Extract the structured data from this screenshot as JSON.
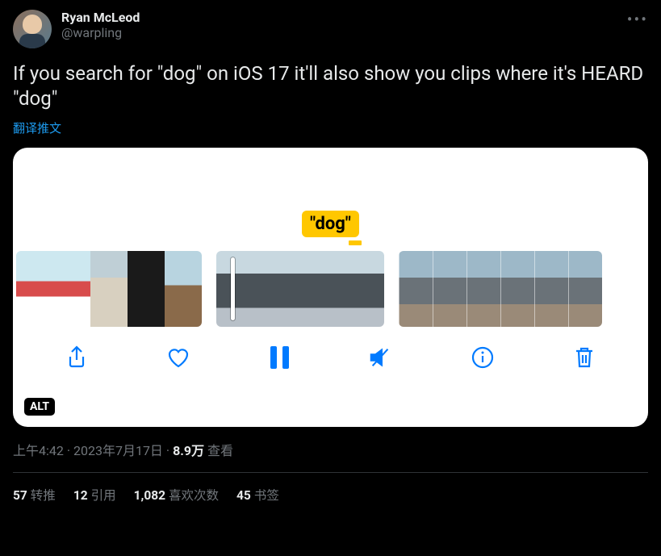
{
  "author": {
    "display_name": "Ryan McLeod",
    "handle": "@warpling"
  },
  "more_icon": "•••",
  "body": "If you search for \"dog\" on iOS 17 it'll also show you clips where it's HEARD \"dog\"",
  "translate_label": "翻译推文",
  "media": {
    "search_badge": "\"dog\"",
    "alt_label": "ALT",
    "toolbar": {
      "share": "share-icon",
      "like": "heart-icon",
      "pause": "pause-icon",
      "mute": "mute-icon",
      "info": "info-icon",
      "trash": "trash-icon"
    }
  },
  "meta": {
    "time": "上午4:42",
    "sep": " · ",
    "date": "2023年7月17日",
    "views_count": "8.9万",
    "views_label": " 查看"
  },
  "stats": {
    "retweets_count": "57",
    "retweets_label": "转推",
    "quotes_count": "12",
    "quotes_label": "引用",
    "likes_count": "1,082",
    "likes_label": "喜欢次数",
    "bookmarks_count": "45",
    "bookmarks_label": "书签"
  }
}
